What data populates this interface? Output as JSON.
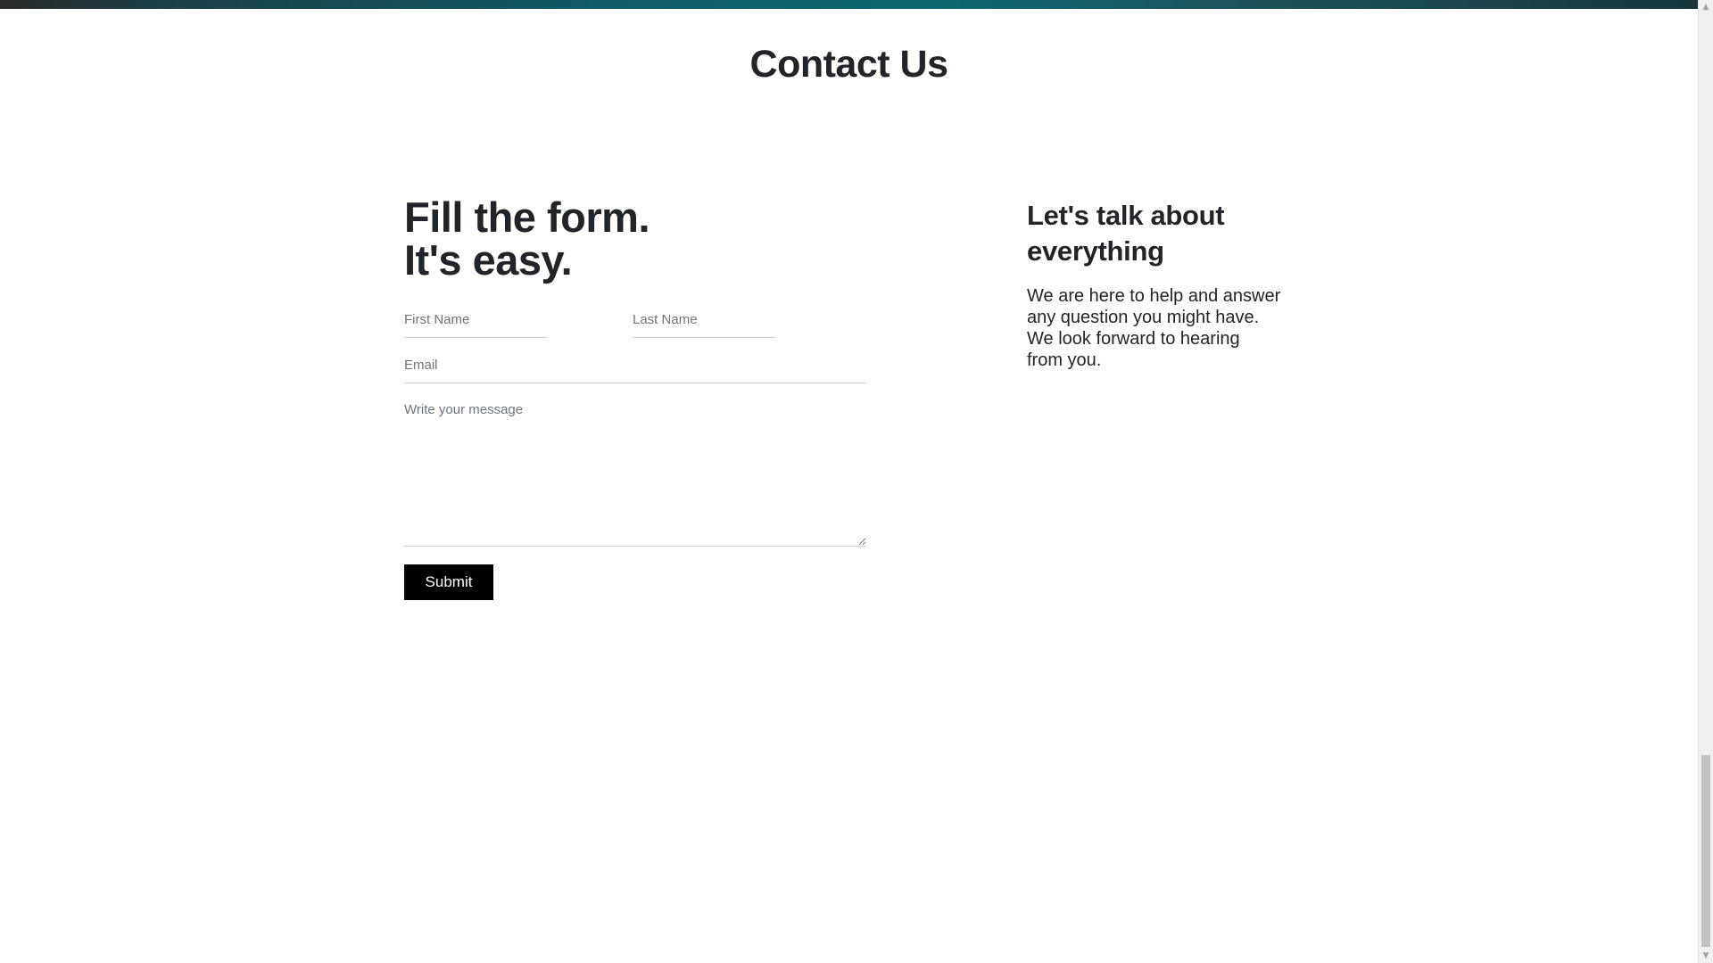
{
  "header": {
    "section_title": "Contact Us"
  },
  "form": {
    "heading_line1": "Fill the form.",
    "heading_line2": "It's easy.",
    "first_name_placeholder": "First Name",
    "last_name_placeholder": "Last Name",
    "email_placeholder": "Email",
    "message_placeholder": "Write your message",
    "submit_label": "Submit"
  },
  "info": {
    "heading_line1": "Let's talk about",
    "heading_line2": "everything",
    "body_line1": "We are here to help and answer",
    "body_line2": "any question you might have.",
    "body_line3": "We look forward to hearing",
    "body_line4": "from you."
  },
  "colors": {
    "text": "#212529",
    "button_bg": "#000000",
    "button_text": "#ffffff",
    "placeholder": "#6c757d"
  },
  "icons": {
    "scroll_up": "triangle-up-icon",
    "scroll_down": "triangle-down-icon"
  }
}
